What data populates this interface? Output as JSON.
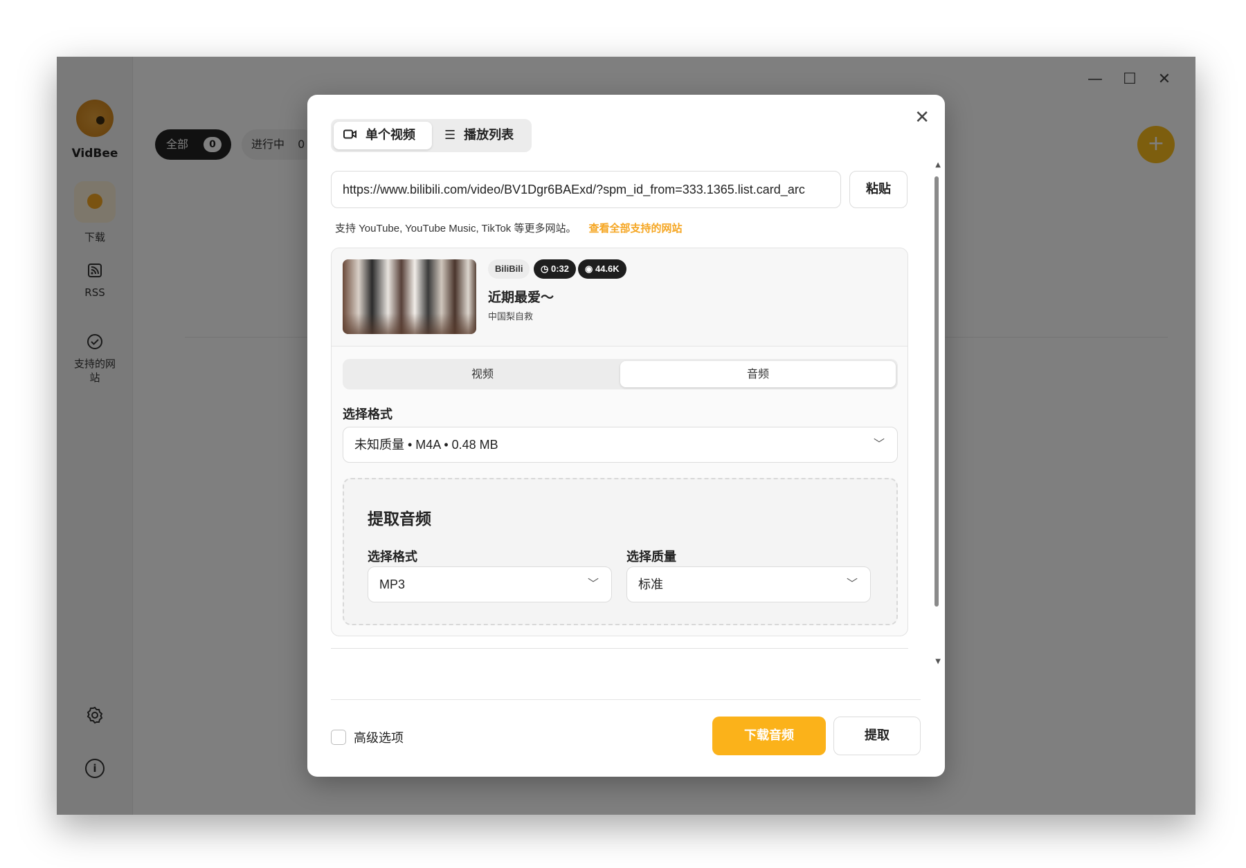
{
  "app": {
    "name": "VidBee",
    "window_controls": {
      "minimize": "—",
      "maximize": "☐",
      "close": "✕"
    }
  },
  "sidebar": {
    "items": [
      {
        "label": "下载",
        "icon": "download-icon"
      },
      {
        "label": "RSS",
        "icon": "rss-icon"
      },
      {
        "label": "支持的网站",
        "icon": "check-circle-icon"
      }
    ],
    "bottom": [
      {
        "icon": "settings-icon"
      },
      {
        "icon": "info-icon"
      }
    ]
  },
  "main": {
    "tabs": [
      {
        "label": "全部",
        "count": "0"
      },
      {
        "label": "进行中",
        "count": "0"
      }
    ],
    "add_button": "+"
  },
  "modal": {
    "mode_tabs": {
      "single": "单个视频",
      "playlist": "播放列表"
    },
    "url_value": "https://www.bilibili.com/video/BV1Dgr6BAExd/?spm_id_from=333.1365.list.card_arc",
    "paste_label": "粘贴",
    "support_text": "支持 YouTube, YouTube Music, TikTok 等更多网站。",
    "support_link": "查看全部支持的网站",
    "video": {
      "source": "BiliBili",
      "duration": "0:32",
      "views": "44.6K",
      "title": "近期最爱～",
      "author": "中国梨自救"
    },
    "media_tabs": {
      "video": "视频",
      "audio": "音频"
    },
    "format_label": "选择格式",
    "format_value": "未知质量 • M4A • 0.48 MB",
    "extract": {
      "title": "提取音频",
      "format_label": "选择格式",
      "format_value": "MP3",
      "quality_label": "选择质量",
      "quality_value": "标准"
    },
    "advanced_label": "高级选项",
    "download_button": "下载音频",
    "cancel_button": "提取"
  },
  "colors": {
    "accent": "#fbb21a",
    "link": "#f5a623"
  }
}
